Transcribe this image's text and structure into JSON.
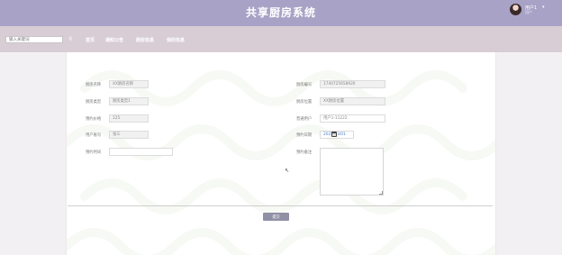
{
  "header": {
    "site_title": "共享厨房系统",
    "username": "用户1",
    "user_sub": "用户",
    "caret": "▾"
  },
  "nav": {
    "search_placeholder": "输入关键词",
    "search_icon": "search-icon",
    "items": [
      "首页",
      "通知公告",
      "厨房信息",
      "我的信息"
    ]
  },
  "form": {
    "kitchen_name_label": "厨房名称",
    "kitchen_name_value": "XX厨房名称",
    "kitchen_no_label": "厨房编号",
    "kitchen_no_value": "1740725658920",
    "kitchen_type_label": "厨房类型",
    "kitchen_type_value": "厨房类型1",
    "kitchen_location_label": "厨房位置",
    "kitchen_location_value": "XX厨房位置",
    "price_label": "预约价格",
    "price_value": "125",
    "user_label": "普通用户",
    "user_value": "用户1-11222",
    "owner_label": "用户账号",
    "owner_value": "张三",
    "date_label": "预约日期",
    "date_value": "2025/03/01",
    "time_label": "预约时间",
    "time_value": "",
    "remark_label": "预约备注",
    "remark_value": ""
  },
  "actions": {
    "submit_label": "提交"
  },
  "colors": {
    "header_bg": "#a8a2c6",
    "nav_bg": "#d8cdd4",
    "button_bg": "#8f8fa6"
  }
}
